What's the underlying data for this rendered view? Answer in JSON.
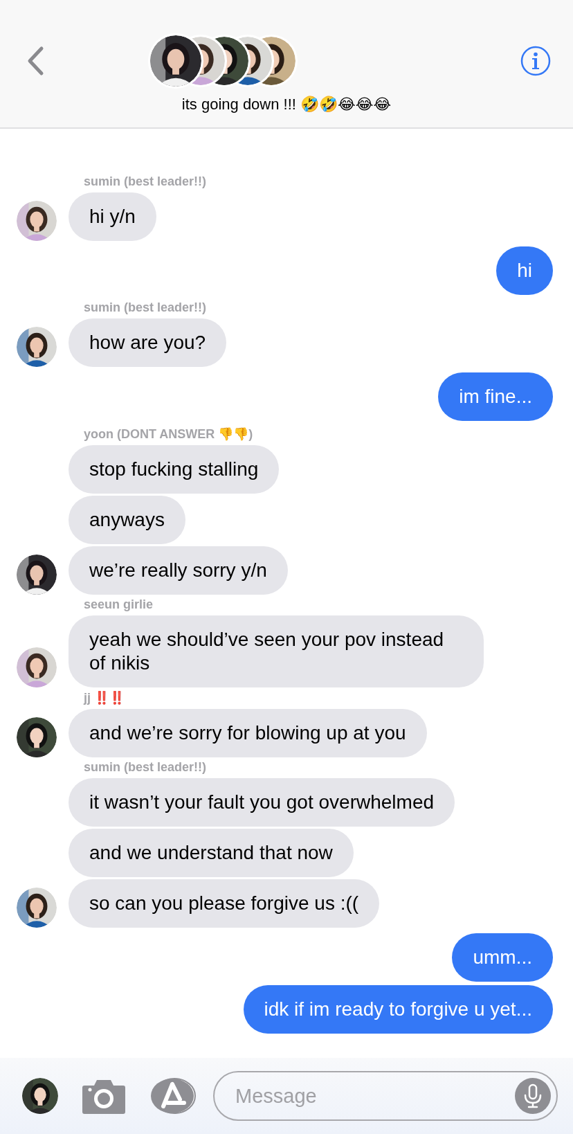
{
  "header": {
    "title": "its going down !!! 🤣🤣😂😂😂"
  },
  "messages": [
    {
      "kind": "incoming",
      "sender": "sumin (best leader!!)",
      "texts": [
        "hi y/n"
      ]
    },
    {
      "kind": "outgoing",
      "texts": [
        "hi"
      ]
    },
    {
      "kind": "incoming",
      "sender": "sumin (best leader!!)",
      "texts": [
        "how are you?"
      ]
    },
    {
      "kind": "outgoing",
      "texts": [
        "im fine..."
      ]
    },
    {
      "kind": "incoming",
      "sender": "yoon (DONT ANSWER 👎👎)",
      "texts": [
        "stop fucking stalling",
        "anyways",
        "we’re really sorry y/n"
      ]
    },
    {
      "kind": "incoming",
      "sender": "seeun girlie",
      "texts": [
        "yeah we should’ve seen your pov instead of nikis"
      ]
    },
    {
      "kind": "incoming",
      "sender": "jj ‼️‼️",
      "texts": [
        " and we’re sorry for blowing up at you"
      ]
    },
    {
      "kind": "incoming",
      "sender": "sumin (best leader!!)",
      "texts": [
        "it wasn’t your fault you got overwhelmed",
        "and we understand that now",
        "so can you please forgive us :(("
      ]
    },
    {
      "kind": "outgoing",
      "texts": [
        "umm...",
        "idk if im ready to forgive u yet..."
      ]
    }
  ],
  "composer": {
    "placeholder": "Message"
  }
}
